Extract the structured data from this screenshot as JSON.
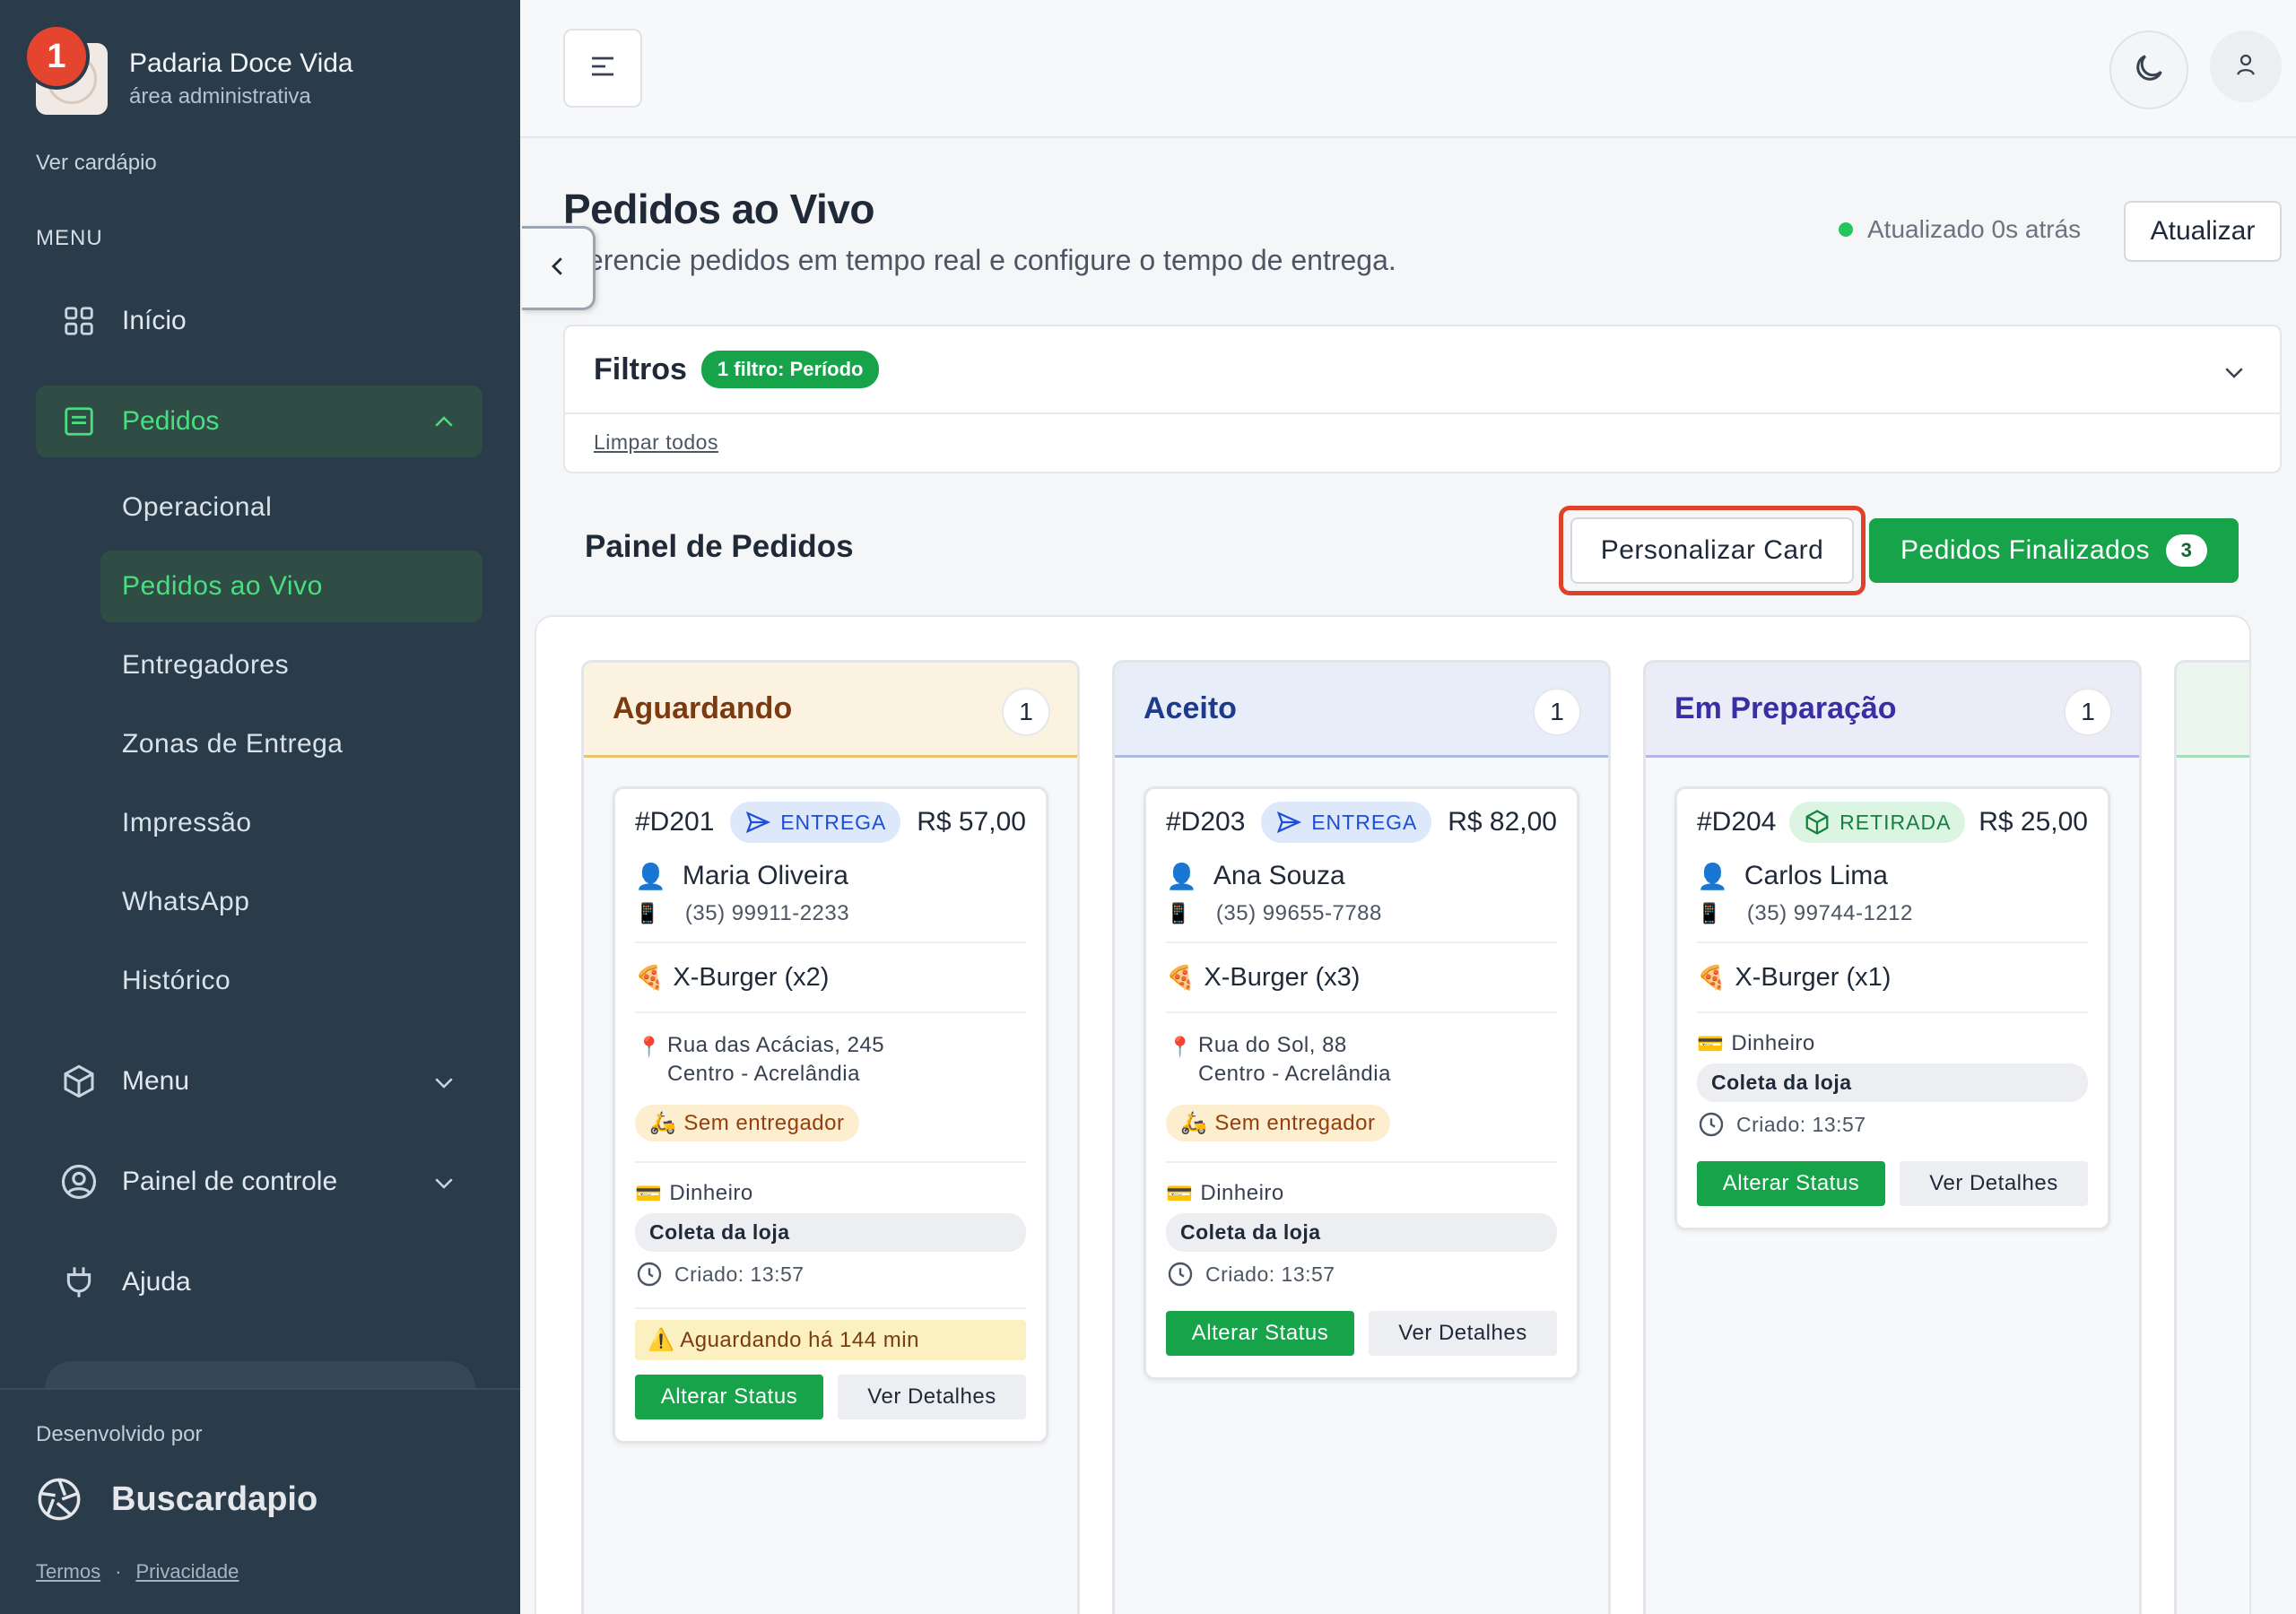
{
  "sidebar": {
    "brand_name": "Padaria Doce Vida",
    "brand_sub": "área administrativa",
    "notification_count": "1",
    "view_menu": "Ver cardápio",
    "menu_label": "MENU",
    "items": {
      "inicio": "Início",
      "pedidos": "Pedidos",
      "menu": "Menu",
      "painel": "Painel de controle",
      "ajuda": "Ajuda"
    },
    "sub_items": [
      "Operacional",
      "Pedidos ao Vivo",
      "Entregadores",
      "Zonas de Entrega",
      "Impressão",
      "WhatsApp",
      "Histórico"
    ],
    "developed_by": "Desenvolvido por",
    "dev_name": "Buscardapio",
    "terms": "Termos",
    "dot": "·",
    "privacy": "Privacidade"
  },
  "page": {
    "title": "Pedidos ao Vivo",
    "subtitle": "Gerencie pedidos em tempo real e configure o tempo de entrega.",
    "updated": "Atualizado 0s atrás",
    "refresh": "Atualizar"
  },
  "filters": {
    "title": "Filtros",
    "badge": "1 filtro: Período",
    "clear_all": "Limpar todos"
  },
  "board": {
    "title": "Painel de Pedidos",
    "customize": "Personalizar Card",
    "finished": "Pedidos Finalizados",
    "finished_count": "3"
  },
  "columns": [
    {
      "title": "Aguardando",
      "count": "1",
      "card": {
        "id": "#D201",
        "type": "ENTREGA",
        "price": "R$ 57,00",
        "customer": "Maria Oliveira",
        "phone": "(35) 99911-2233",
        "item": "X-Burger (x2)",
        "address1": "Rua das Acácias, 245",
        "address2": "Centro - Acrelândia",
        "driver": "Sem entregador",
        "payment": "Dinheiro",
        "pickup": "Coleta da loja",
        "created": "Criado: 13:57",
        "warning": "⚠️ Aguardando há 144 min",
        "status_btn": "Alterar Status",
        "details_btn": "Ver Detalhes"
      }
    },
    {
      "title": "Aceito",
      "count": "1",
      "card": {
        "id": "#D203",
        "type": "ENTREGA",
        "price": "R$ 82,00",
        "customer": "Ana Souza",
        "phone": "(35) 99655-7788",
        "item": "X-Burger (x3)",
        "address1": "Rua do Sol, 88",
        "address2": "Centro - Acrelândia",
        "driver": "Sem entregador",
        "payment": "Dinheiro",
        "pickup": "Coleta da loja",
        "created": "Criado: 13:57",
        "status_btn": "Alterar Status",
        "details_btn": "Ver Detalhes"
      }
    },
    {
      "title": "Em Preparação",
      "count": "1",
      "card": {
        "id": "#D204",
        "type": "RETIRADA",
        "price": "R$ 25,00",
        "customer": "Carlos Lima",
        "phone": "(35) 99744-1212",
        "item": "X-Burger (x1)",
        "payment": "Dinheiro",
        "pickup": "Coleta da loja",
        "created": "Criado: 13:57",
        "status_btn": "Alterar Status",
        "details_btn": "Ver Detalhes"
      }
    }
  ],
  "colors": {
    "sidebar_bg": "#2a3b4a",
    "accent_green": "#16a34a",
    "highlight_red": "#e0412b"
  }
}
